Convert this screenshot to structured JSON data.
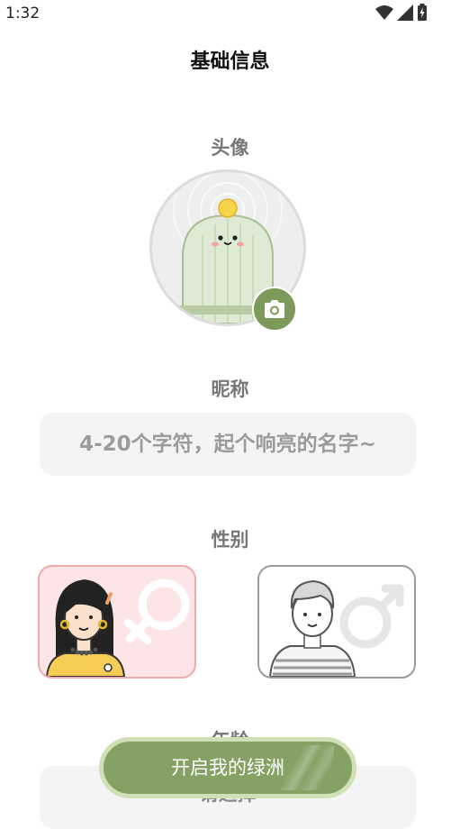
{
  "status_bar": {
    "time": "1:32"
  },
  "page": {
    "title": "基础信息"
  },
  "avatar": {
    "label": "头像"
  },
  "nickname": {
    "label": "昵称",
    "placeholder": "4-20个字符，起个响亮的名字~",
    "value": ""
  },
  "gender": {
    "label": "性别",
    "options": [
      {
        "id": "female",
        "icon": "female-symbol-icon",
        "selected": true
      },
      {
        "id": "male",
        "icon": "male-symbol-icon",
        "selected": false
      }
    ]
  },
  "age": {
    "label": "年龄",
    "placeholder": "请选择"
  },
  "cta": {
    "label": "开启我的绿洲"
  },
  "colors": {
    "accent_green": "#85a264",
    "camera_green": "#7c9a5a",
    "female_bg": "#fde4e6",
    "female_border": "#f2a9ae",
    "label_gray": "#777777"
  }
}
